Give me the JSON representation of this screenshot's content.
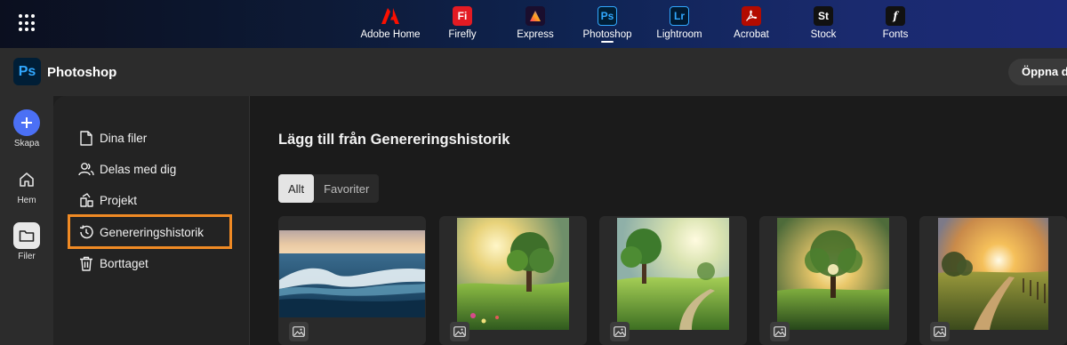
{
  "topnav": {
    "apps": [
      {
        "label": "Adobe Home",
        "glyph": "A",
        "color": "#1a1a1a",
        "fg": "#fa0f00"
      },
      {
        "label": "Firefly",
        "glyph": "Fi",
        "color": "#e31b23",
        "fg": "#ffffff"
      },
      {
        "label": "Express",
        "glyph": "A",
        "color": "#1a0e2e",
        "fg": "#ff5fa0"
      },
      {
        "label": "Photoshop",
        "glyph": "Ps",
        "color": "#001e36",
        "fg": "#31a8ff"
      },
      {
        "label": "Lightroom",
        "glyph": "Lr",
        "color": "#001a33",
        "fg": "#31a8ff"
      },
      {
        "label": "Acrobat",
        "glyph": "A",
        "color": "#b30b00",
        "fg": "#ffffff"
      },
      {
        "label": "Stock",
        "glyph": "St",
        "color": "#111111",
        "fg": "#ffffff"
      },
      {
        "label": "Fonts",
        "glyph": "f",
        "color": "#111111",
        "fg": "#ffffff"
      }
    ],
    "active_app": "Photoshop"
  },
  "header": {
    "app_name": "Photoshop",
    "logo_text": "Ps",
    "open_button": "Öppna da"
  },
  "rail": {
    "create": "Skapa",
    "home": "Hem",
    "files": "Filer"
  },
  "sidebar": {
    "items": [
      {
        "label": "Dina filer",
        "icon": "document-icon"
      },
      {
        "label": "Delas med dig",
        "icon": "people-icon"
      },
      {
        "label": "Projekt",
        "icon": "project-icon"
      },
      {
        "label": "Genereringshistorik",
        "icon": "history-icon",
        "selected": true
      },
      {
        "label": "Borttaget",
        "icon": "trash-icon"
      }
    ]
  },
  "main": {
    "title": "Lägg till från Genereringshistorik",
    "tabs": [
      "Allt",
      "Favoriter"
    ],
    "active_tab": "Allt",
    "cards": [
      {
        "subject": "ocean waves at sunset"
      },
      {
        "subject": "sunlit meadow with tree"
      },
      {
        "subject": "meadow path with tree"
      },
      {
        "subject": "lone tree at sunrise"
      },
      {
        "subject": "country path at sunset"
      }
    ]
  },
  "colors": {
    "highlight": "#f08a24",
    "create_button": "#4b70f5",
    "photoshop_blue": "#31a8ff"
  }
}
